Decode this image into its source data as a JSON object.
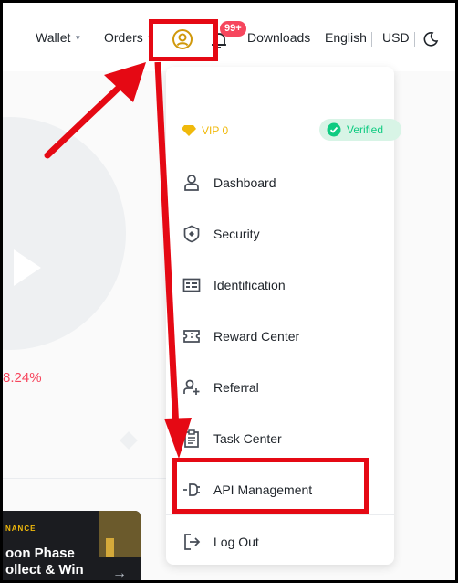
{
  "topbar": {
    "wallet": "Wallet",
    "orders": "Orders",
    "notification_count": "99+",
    "downloads": "Downloads",
    "language": "English",
    "currency": "USD"
  },
  "background": {
    "change_percent": "8.24%",
    "banner": {
      "brand": "NANCE",
      "line1": "oon Phase",
      "line2": "ollect & Win"
    }
  },
  "menu": {
    "vip": "VIP 0",
    "verified": "Verified",
    "items": [
      {
        "label": "Dashboard",
        "icon": "user-icon"
      },
      {
        "label": "Security",
        "icon": "shield-icon"
      },
      {
        "label": "Identification",
        "icon": "id-card-icon"
      },
      {
        "label": "Reward Center",
        "icon": "ticket-icon"
      },
      {
        "label": "Referral",
        "icon": "user-plus-icon"
      },
      {
        "label": "Task Center",
        "icon": "clipboard-icon"
      },
      {
        "label": "API Management",
        "icon": "plug-icon"
      },
      {
        "label": "Log Out",
        "icon": "logout-icon"
      }
    ]
  },
  "colors": {
    "accent": "#f0b90b",
    "annotation": "#e50914",
    "verified": "#0ecb81",
    "negative": "#f6465d"
  }
}
